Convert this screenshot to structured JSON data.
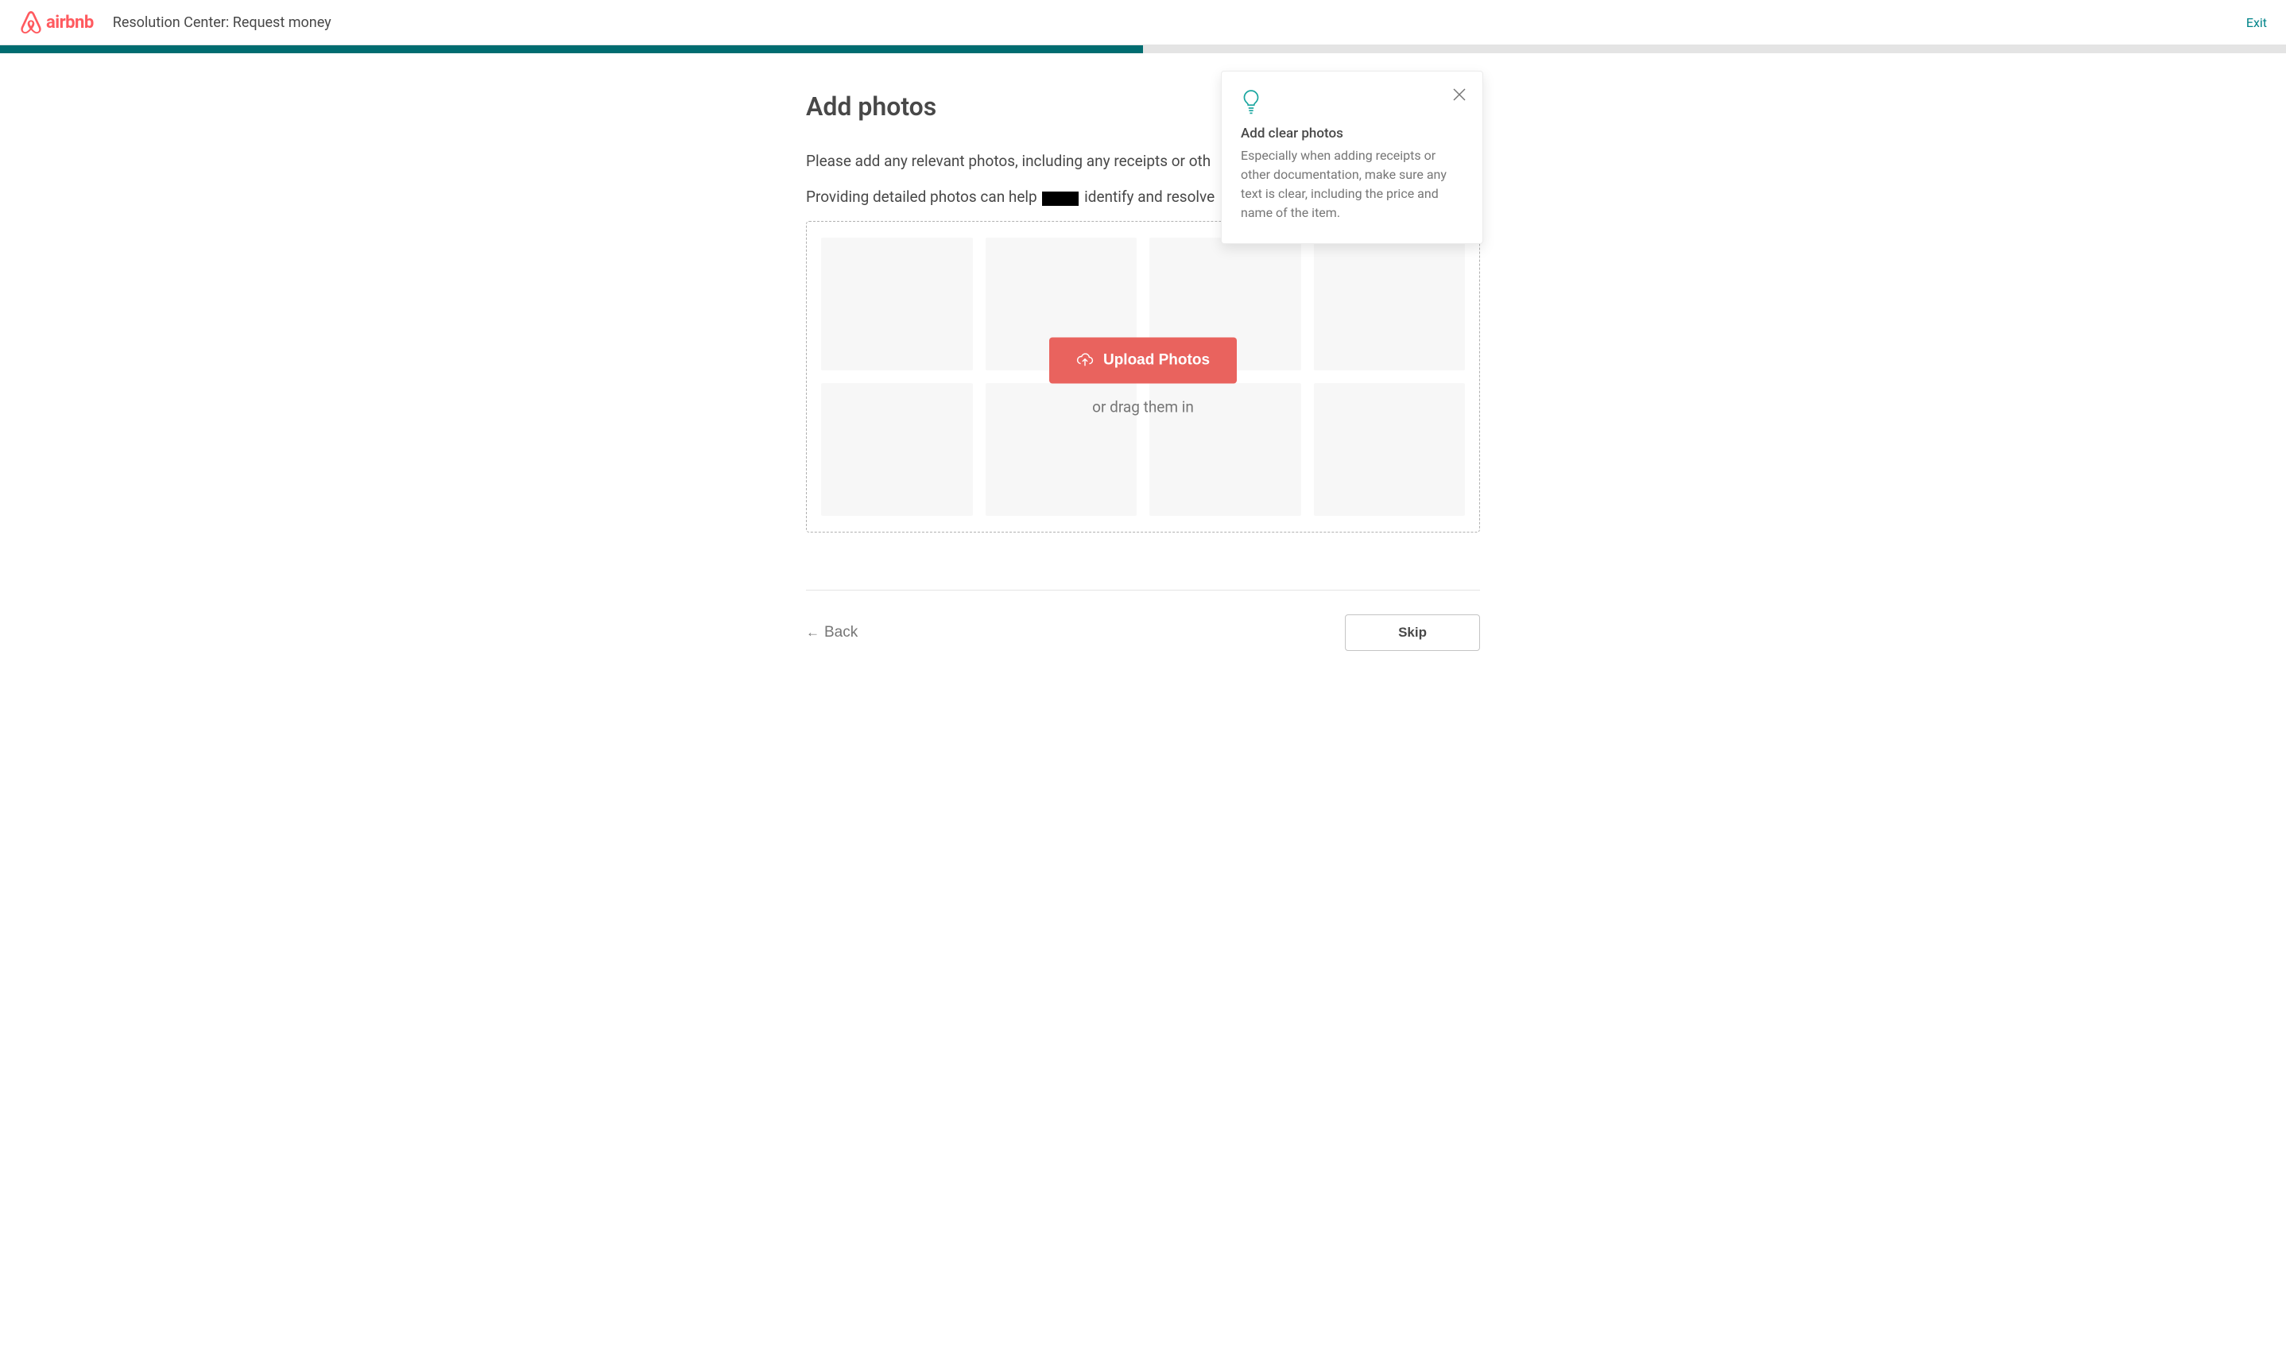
{
  "header": {
    "brand": "airbnb",
    "title": "Resolution Center: Request money",
    "exit_label": "Exit"
  },
  "progress": {
    "percent": 50
  },
  "main": {
    "title": "Add photos",
    "line1_prefix": "Please add any relevant photos, including any receipts or oth",
    "line2_prefix": "Providing detailed photos can help ",
    "line2_suffix": " identify and resolve "
  },
  "dropzone": {
    "upload_label": "Upload Photos",
    "drag_hint": "or drag them in"
  },
  "tip": {
    "title": "Add clear photos",
    "body": "Especially when adding receipts or other documentation, make sure any text is clear, including the price and name of the item."
  },
  "footer": {
    "back_label": "Back",
    "skip_label": "Skip"
  }
}
